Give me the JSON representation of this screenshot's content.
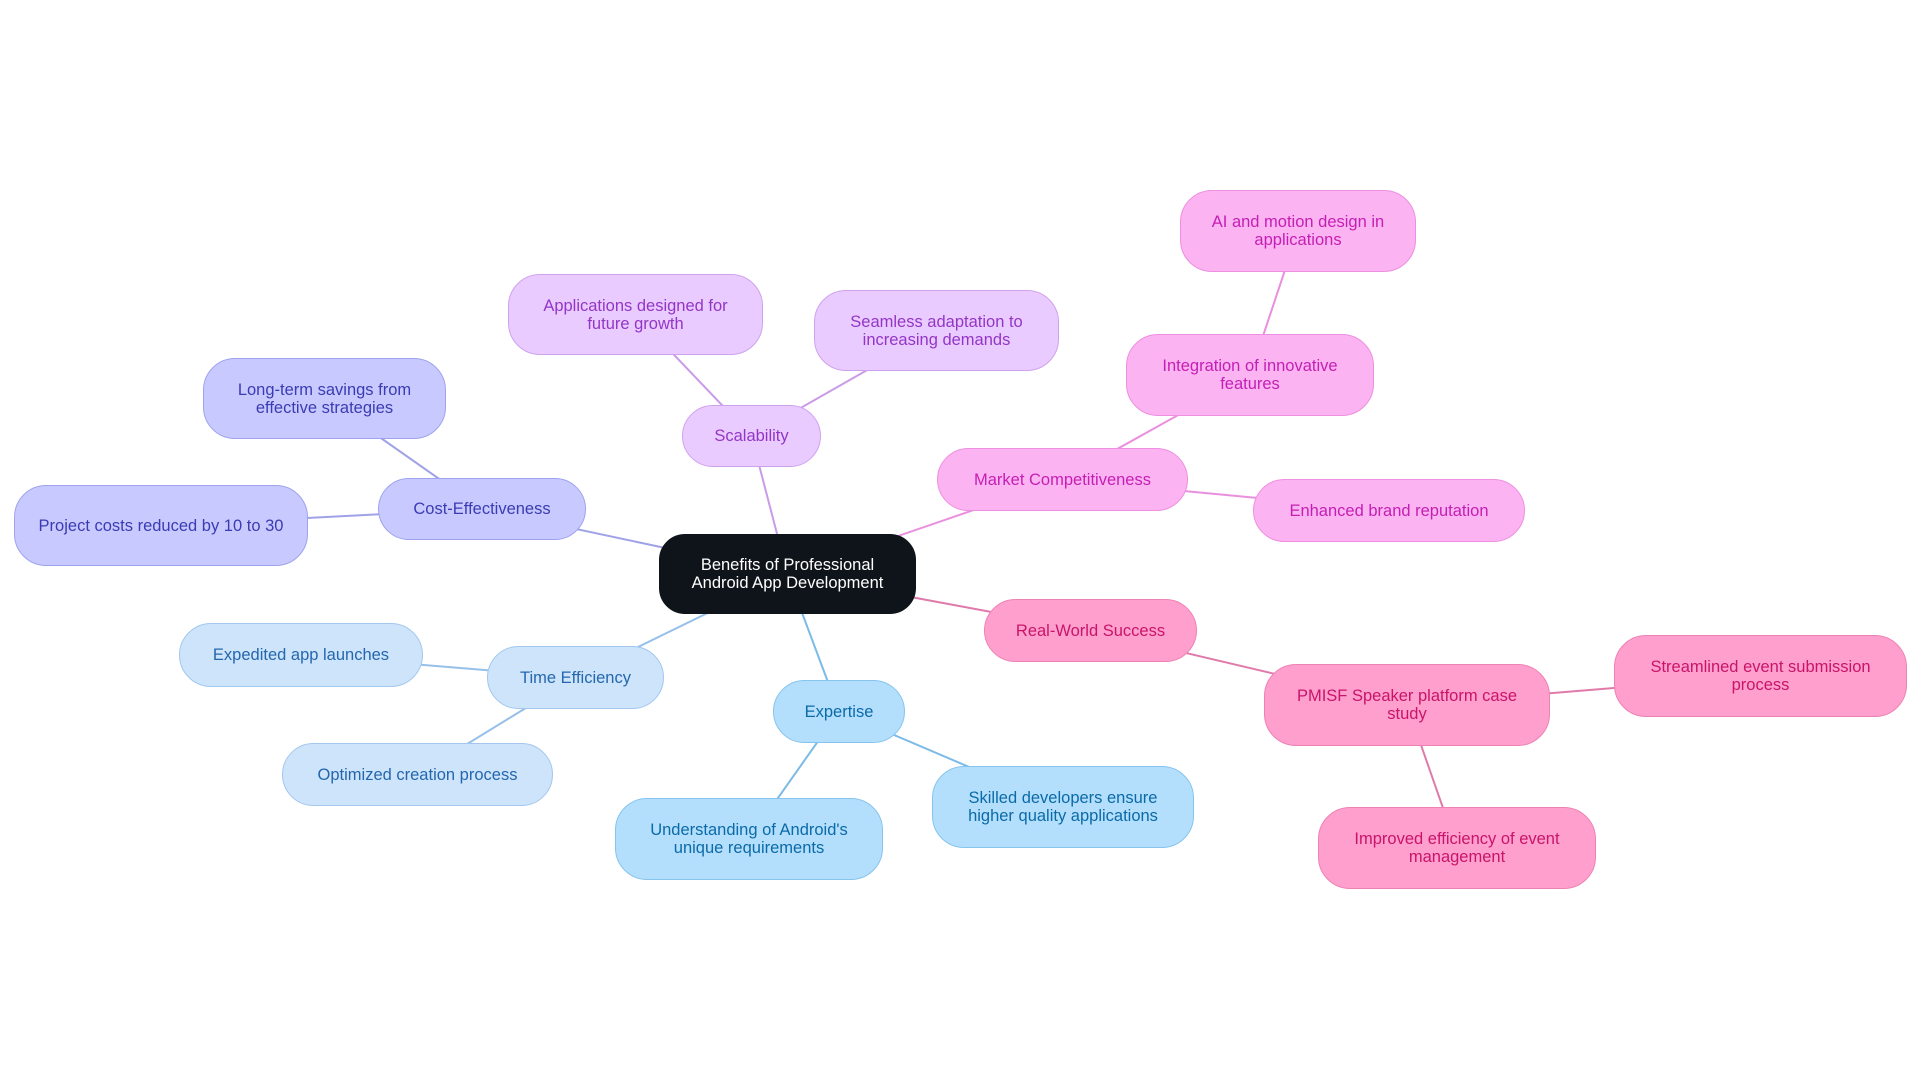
{
  "diagram": {
    "type": "mind-map",
    "root": "Benefits of Professional Android App Development",
    "colors": {
      "root": "#0f141b",
      "cost_effectiveness": "#c8caff",
      "scalability": "#eacbff",
      "market_competitiveness": "#fcb3f2",
      "real_world_success": "#ff9fcd",
      "time_efficiency": "#cde4fb",
      "expertise": "#b3dffc",
      "edge_cost": "#9fa2e6",
      "edge_scal": "#c99be8",
      "edge_mark": "#ea8fde",
      "edge_real": "#e07aab",
      "edge_time": "#96c0ea",
      "edge_expt": "#7bbbe6"
    },
    "nodes": {
      "root": "Benefits of Professional Android App Development",
      "cost": "Cost-Effectiveness",
      "cost_savings": "Long-term savings from effective strategies",
      "cost_reduced": "Project costs reduced by 10 to 30",
      "scal": "Scalability",
      "scal_growth": "Applications designed for future growth",
      "scal_adapt": "Seamless adaptation to increasing demands",
      "mark": "Market Competitiveness",
      "mark_integration": "Integration of innovative features",
      "mark_ai": "AI and motion design in applications",
      "mark_brand": "Enhanced brand reputation",
      "real": "Real-World Success",
      "real_pmisf": "PMISF Speaker platform case study",
      "real_streamlined": "Streamlined event submission process",
      "real_improved": "Improved efficiency of event management",
      "time": "Time Efficiency",
      "time_expedited": "Expedited app launches",
      "time_optimized": "Optimized creation process",
      "expt": "Expertise",
      "expt_understanding": "Understanding of Android's unique requirements",
      "expt_skilled": "Skilled developers ensure higher quality applications"
    }
  }
}
